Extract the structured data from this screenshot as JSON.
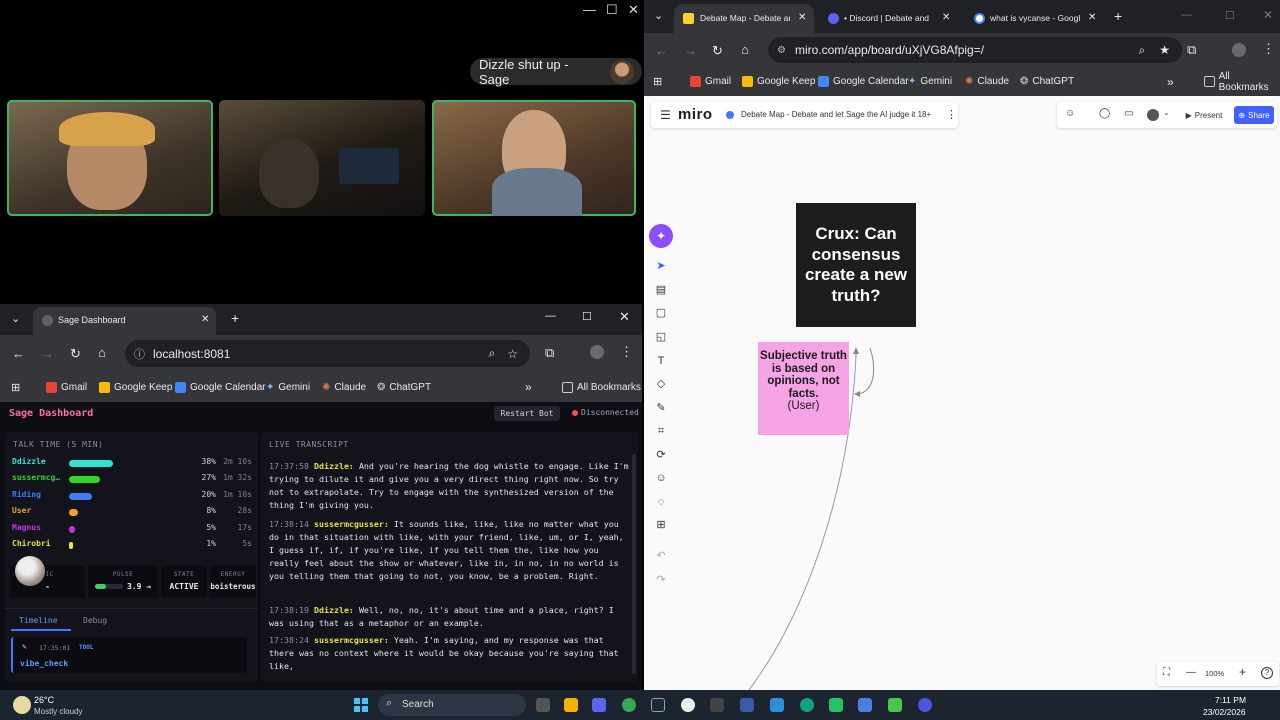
{
  "call": {
    "speaker_pill": "Dizzle shut up - Sage",
    "minimize": "—",
    "maximize": "☐",
    "close": "✕"
  },
  "dash_browser": {
    "tab_title": "Sage Dashboard",
    "url": "localhost:8081",
    "new_tab": "+",
    "bookmarks": [
      "Gmail",
      "Google Keep",
      "Google Calendar",
      "Gemini",
      "Claude",
      "ChatGPT"
    ],
    "all_bookmarks": "All Bookmarks",
    "more_bookmarks": "»"
  },
  "dashboard": {
    "title": "Sage Dashboard",
    "restart_label": "Restart Bot",
    "status": "Disconnected",
    "talk_time_heading": "TALK TIME (5 MIN)",
    "speakers": [
      {
        "name": "Ddizzle",
        "pct": "38%",
        "time": "2m 10s",
        "share": 0.38,
        "color": "#2de3d2"
      },
      {
        "name": "sussermcg…",
        "pct": "27%",
        "time": "1m 32s",
        "share": 0.27,
        "color": "#34d52a"
      },
      {
        "name": "Riding",
        "pct": "20%",
        "time": "1m 10s",
        "share": 0.2,
        "color": "#3f7ef5"
      },
      {
        "name": "User",
        "pct": "8%",
        "time": "28s",
        "share": 0.08,
        "color": "#f0a21a"
      },
      {
        "name": "Magnus",
        "pct": "5%",
        "time": "17s",
        "share": 0.05,
        "color": "#c230e8"
      },
      {
        "name": "Chirobri",
        "pct": "1%",
        "time": "5s",
        "share": 0.01,
        "color": "#e8e23a"
      }
    ],
    "stats": {
      "topic_label": "PIC",
      "topic_value": "-",
      "pulse_label": "PULSE",
      "pulse_value": "3.9 →",
      "pulse_level": 0.39,
      "state_label": "STATE",
      "state_value": "ACTIVE",
      "energy_label": "ENERGY",
      "energy_value": "boisterous"
    },
    "tabs": [
      "Timeline",
      "Debug"
    ],
    "timeline_time": "17:35:01",
    "timeline_tag": "TOOL",
    "timeline_event": "vibe_check",
    "transcript_heading": "LIVE TRANSCRIPT",
    "transcript": [
      {
        "time": "17:37:58",
        "speaker": "Ddizzle:",
        "color": "#e8e23a",
        "text": "And you're hearing the dog whistle to engage. Like I'm trying to dilute it and give you a very direct thing right now. So try not to extrapolate. Try to engage with the synthesized version of the thing I'm giving you."
      },
      {
        "time": "17:38:14",
        "speaker": "sussermcgusser:",
        "color": "#e8e23a",
        "text": "It sounds like, like, like no matter what you do in that situation with like, with your friend, like, um, or I, yeah, I guess if, if, if you're like, if you tell them the, like how you really feel about the show or whatever, like in, in no, in no world is you telling them that going to not, you know, be a problem. Right."
      },
      {
        "time": "17:38:19",
        "speaker": "Ddizzle:",
        "color": "#e8e23a",
        "text": "Well, no, no, it's about time and a place, right? I was using that as a metaphor or an example."
      },
      {
        "time": "17:38:24",
        "speaker": "sussermcgusser:",
        "color": "#e8e23a",
        "text": "Yeah. I'm saying, and my response was that there was no context where it would be okay because you're saying that like,"
      }
    ]
  },
  "miro_browser": {
    "tabs": [
      "Debate Map - Debate and",
      "• Discord | Debate and",
      "what is vycanse - Googl"
    ],
    "url": "miro.com/app/board/uXjVG8Afpig=/",
    "bookmarks": [
      "Gmail",
      "Google Keep",
      "Google Calendar",
      "Gemini",
      "Claude",
      "ChatGPT"
    ],
    "all_bookmarks": "All Bookmarks",
    "more_bookmarks": "»",
    "new_tab": "+"
  },
  "miro": {
    "logo": "miro",
    "board_title": "Debate Map - Debate and let Sage the AI judge it 18+",
    "present_label": "Present",
    "share_label": "Share",
    "crux_text": "Crux: Can consensus create a new truth?",
    "opinion_text": "Subjective truth is based on opinions, not facts.",
    "opinion_author": "(User)",
    "zoom": "100%",
    "zoom_out": "—",
    "zoom_in": "+",
    "help": "?"
  },
  "taskbar": {
    "temperature": "26°C",
    "weather": "Mostly cloudy",
    "search_placeholder": "Search",
    "time": "7:11 PM",
    "date": "23/02/2026"
  }
}
